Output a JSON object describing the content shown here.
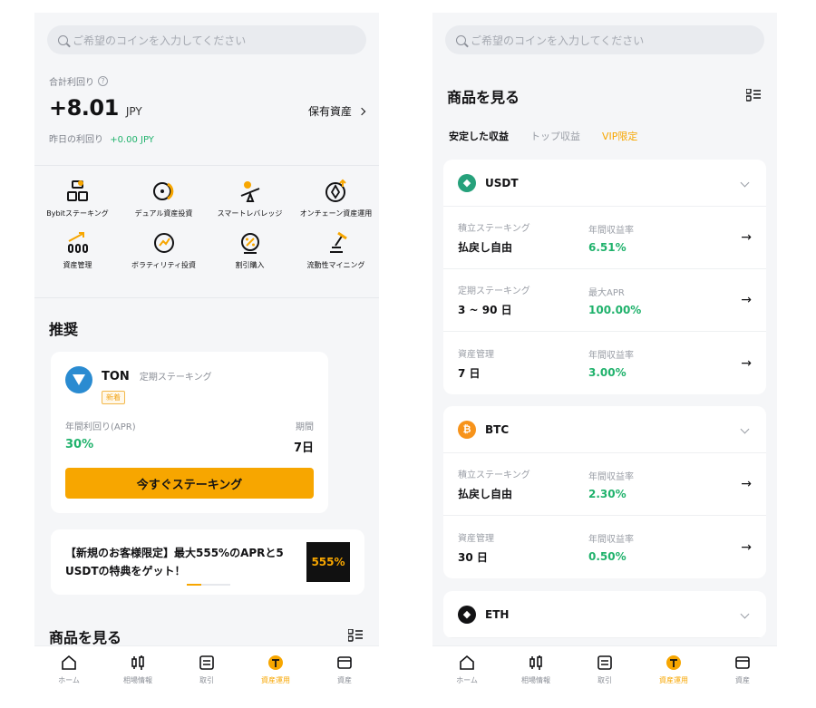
{
  "left": {
    "search_placeholder": "ご希望のコインを入力してください",
    "summary": {
      "label": "合計利回り",
      "value": "+8.01",
      "unit": "JPY",
      "holdings_link": "保有資産",
      "yesterday_label": "昨日の利回り",
      "yesterday_value": "+0.00 JPY"
    },
    "features": [
      {
        "label": "Bybitステーキング",
        "icon": "bybit-staking-icon"
      },
      {
        "label": "デュアル資産投資",
        "icon": "dual-asset-icon"
      },
      {
        "label": "スマートレバレッジ",
        "icon": "smart-leverage-icon"
      },
      {
        "label": "オンチェーン資産運用",
        "icon": "onchain-earn-icon"
      },
      {
        "label": "資産管理",
        "icon": "wealth-management-icon"
      },
      {
        "label": "ボラティリティ投資",
        "icon": "volatility-icon"
      },
      {
        "label": "割引購入",
        "icon": "discount-buy-icon"
      },
      {
        "label": "流動性マイニング",
        "icon": "liquidity-mining-icon"
      }
    ],
    "recommend": {
      "title": "推奨",
      "coin": "TON",
      "type": "定期ステーキング",
      "tag": "新着",
      "apr_label": "年間利回り(APR)",
      "apr_value": "30%",
      "period_label": "期間",
      "period_value": "7日",
      "button": "今すぐステーキング"
    },
    "promo": {
      "text": "【新規のお客様限定】最大555%のAPRと5 USDTの特典をゲット！",
      "image_text": "555%"
    },
    "products_title": "商品を見る"
  },
  "right": {
    "search_placeholder": "ご希望のコインを入力してください",
    "title": "商品を見る",
    "filters": [
      "安定した収益",
      "トップ収益",
      "VIP限定"
    ],
    "coins": [
      {
        "name": "USDT",
        "logo_color": "#26a17b",
        "logo_icon": "usdt-logo-icon",
        "products": [
          {
            "type": "積立ステーキング",
            "term": "払戻し自由",
            "rate_label": "年間収益率",
            "rate": "6.51%"
          },
          {
            "type": "定期ステーキング",
            "term": "3 ~ 90 日",
            "rate_label": "最大APR",
            "rate": "100.00%"
          },
          {
            "type": "資産管理",
            "term": "7 日",
            "rate_label": "年間収益率",
            "rate": "3.00%"
          }
        ]
      },
      {
        "name": "BTC",
        "logo_color": "#f7931a",
        "logo_icon": "btc-logo-icon",
        "products": [
          {
            "type": "積立ステーキング",
            "term": "払戻し自由",
            "rate_label": "年間収益率",
            "rate": "2.30%"
          },
          {
            "type": "資産管理",
            "term": "30 日",
            "rate_label": "年間収益率",
            "rate": "0.50%"
          }
        ]
      },
      {
        "name": "ETH",
        "logo_color": "#121214",
        "logo_icon": "eth-logo-icon",
        "products": []
      }
    ]
  },
  "nav": [
    {
      "label": "ホーム",
      "icon": "home-icon"
    },
    {
      "label": "相場情報",
      "icon": "market-icon"
    },
    {
      "label": "取引",
      "icon": "trade-icon"
    },
    {
      "label": "資産運用",
      "icon": "earn-icon",
      "active": true
    },
    {
      "label": "資産",
      "icon": "wallet-icon"
    }
  ],
  "colors": {
    "accent": "#f7a600",
    "positive": "#20b26c",
    "background": "#f5f6f8"
  }
}
